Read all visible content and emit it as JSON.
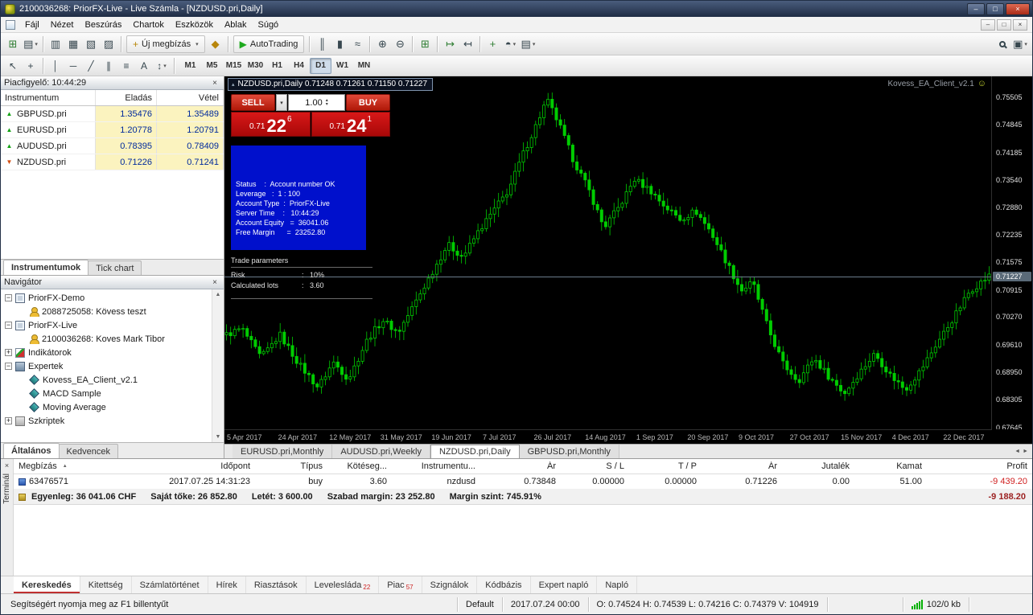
{
  "window": {
    "title": "2100036268: PriorFX-Live - Live Számla - [NZDUSD.pri,Daily]",
    "controls": [
      {
        "name": "minimize-button",
        "glyph": "–"
      },
      {
        "name": "restore-button",
        "glyph": "□"
      },
      {
        "name": "close-button",
        "glyph": "×"
      }
    ]
  },
  "icons": {
    "close": "×",
    "dropdown": "▾",
    "sort_asc": "▲",
    "smiley": "☺",
    "collapse": "▴",
    "tab_left": "◄",
    "tab_right": "►",
    "scroll_up": "▲",
    "scroll_down": "▼",
    "spin_up": "▴",
    "spin_down": "▾"
  },
  "menu": {
    "items": [
      "Fájl",
      "Nézet",
      "Beszúrás",
      "Chartok",
      "Eszközök",
      "Ablak",
      "Súgó"
    ],
    "mdi_controls": [
      {
        "name": "child-minimize-button",
        "glyph": "–"
      },
      {
        "name": "child-restore-button",
        "glyph": "□"
      },
      {
        "name": "child-close-button",
        "glyph": "×"
      }
    ]
  },
  "toolbar": {
    "main_icons": [
      {
        "name": "new-chart-icon",
        "glyph": "⊞",
        "color": "#2e7d32"
      },
      {
        "name": "profiles-icon",
        "glyph": "▤",
        "color": "#37474f",
        "arrow": true
      },
      {
        "sep": true
      },
      {
        "name": "market-watch-icon",
        "glyph": "▥",
        "color": "#37474f"
      },
      {
        "name": "data-window-icon",
        "glyph": "▦",
        "color": "#37474f"
      },
      {
        "name": "navigator-icon",
        "glyph": "▧",
        "color": "#37474f"
      },
      {
        "name": "terminal-icon",
        "glyph": "▨",
        "color": "#37474f"
      },
      {
        "sep": true
      },
      {
        "name": "new-order-button",
        "glyph": "+",
        "color": "#b8860b",
        "label": "Új megbízás",
        "arrow": true
      },
      {
        "name": "metaeditor-icon",
        "glyph": "◆",
        "color": "#b8860b"
      },
      {
        "sep": true
      },
      {
        "name": "autotrading-button",
        "glyph": "▶",
        "color": "#1faa1f",
        "label": "AutoTrading"
      },
      {
        "sep": true
      },
      {
        "name": "bar-chart-icon",
        "glyph": "║",
        "color": "#37474f"
      },
      {
        "name": "candlestick-chart-icon",
        "glyph": "▮",
        "color": "#37474f"
      },
      {
        "name": "line-chart-icon",
        "glyph": "≈",
        "color": "#37474f"
      },
      {
        "sep": true
      },
      {
        "name": "zoom-in-icon",
        "glyph": "⊕",
        "color": "#37474f"
      },
      {
        "name": "zoom-out-icon",
        "glyph": "⊖",
        "color": "#37474f"
      },
      {
        "sep": true
      },
      {
        "name": "tile-windows-icon",
        "glyph": "⊞",
        "color": "#2e7d32"
      },
      {
        "sep": true
      },
      {
        "name": "auto-scroll-icon",
        "glyph": "↦",
        "color": "#2e7d32"
      },
      {
        "name": "chart-shift-icon",
        "glyph": "↤",
        "color": "#37474f"
      },
      {
        "sep": true
      },
      {
        "name": "indicators-icon",
        "glyph": "+",
        "color": "#2e7d32"
      },
      {
        "name": "periods-icon",
        "glyph": "◓",
        "color": "#37474f",
        "arrow": true
      },
      {
        "name": "templates-icon",
        "glyph": "▤",
        "color": "#37474f",
        "arrow": true
      }
    ],
    "right_icons": [
      {
        "name": "search-icon",
        "glyph": "magnifier"
      },
      {
        "name": "window-layout-icon",
        "glyph": "▣",
        "color": "#37474f",
        "arrow": true
      }
    ],
    "draw_icons": [
      {
        "name": "cursor-icon",
        "glyph": "↖"
      },
      {
        "name": "crosshair-icon",
        "glyph": "+"
      },
      {
        "sep": true
      },
      {
        "name": "vertical-line-icon",
        "glyph": "│"
      },
      {
        "name": "horizontal-line-icon",
        "glyph": "─"
      },
      {
        "name": "trendline-icon",
        "glyph": "╱"
      },
      {
        "name": "channel-icon",
        "glyph": "∥"
      },
      {
        "name": "fibonacci-icon",
        "glyph": "≡"
      },
      {
        "name": "text-icon",
        "glyph": "A"
      },
      {
        "name": "arrows-icon",
        "glyph": "↕",
        "arrow": true
      },
      {
        "sep": true
      }
    ],
    "timeframes": [
      "M1",
      "M5",
      "M15",
      "M30",
      "H1",
      "H4",
      "D1",
      "W1",
      "MN"
    ],
    "active_timeframe": "D1"
  },
  "market_watch": {
    "title": "Piacfigyelő: 10:44:29",
    "columns": [
      "Instrumentum",
      "Eladás",
      "Vétel"
    ],
    "rows": [
      {
        "symbol": "GBPUSD.pri",
        "bid": "1.35476",
        "ask": "1.35489",
        "dir": "up"
      },
      {
        "symbol": "EURUSD.pri",
        "bid": "1.20778",
        "ask": "1.20791",
        "dir": "up"
      },
      {
        "symbol": "AUDUSD.pri",
        "bid": "0.78395",
        "ask": "0.78409",
        "dir": "up"
      },
      {
        "symbol": "NZDUSD.pri",
        "bid": "0.71226",
        "ask": "0.71241",
        "dir": "down"
      }
    ],
    "tabs": [
      {
        "label": "Instrumentumok",
        "active": true
      },
      {
        "label": "Tick chart",
        "active": false
      }
    ]
  },
  "navigator": {
    "title": "Navigátor",
    "tree": [
      {
        "label": "PriorFX-Demo",
        "depth": 0,
        "icon": "platform",
        "expand": "open"
      },
      {
        "label": "2088725058: Kövess teszt",
        "depth": 1,
        "icon": "account"
      },
      {
        "label": "PriorFX-Live",
        "depth": 0,
        "icon": "platform",
        "expand": "open"
      },
      {
        "label": "2100036268: Koves Mark Tibor",
        "depth": 1,
        "icon": "account"
      },
      {
        "label": "Indikátorok",
        "depth": 0,
        "icon": "indicators",
        "expand": "closed"
      },
      {
        "label": "Expertek",
        "depth": 0,
        "icon": "experts",
        "expand": "open"
      },
      {
        "label": "Kovess_EA_Client_v2.1",
        "depth": 1,
        "icon": "expert"
      },
      {
        "label": "MACD Sample",
        "depth": 1,
        "icon": "expert"
      },
      {
        "label": "Moving Average",
        "depth": 1,
        "icon": "expert"
      },
      {
        "label": "Szkriptek",
        "depth": 0,
        "icon": "scripts",
        "expand": "closed"
      }
    ],
    "tabs": [
      {
        "label": "Általános",
        "active": true
      },
      {
        "label": "Kedvencek",
        "active": false
      }
    ]
  },
  "chart": {
    "header": "NZDUSD.pri,Daily  0.71248 0.71261 0.71150 0.71227",
    "ea_name": "Kovess_EA_Client_v2.1",
    "one_click": {
      "sell_label": "SELL",
      "buy_label": "BUY",
      "lots": "1.00",
      "sell_small": "0.71",
      "sell_big": "22",
      "sell_sup": "6",
      "buy_small": "0.71",
      "buy_big": "24",
      "buy_sup": "1"
    },
    "info_lines": [
      "Status    :  Account number OK",
      "Leverage   :  1 : 100",
      "Account Type  :  PriorFX-Live",
      "Server Time    :   10:44:29",
      "Account Equity   =  36041.06",
      "Free Margin      =  23252.80"
    ],
    "params_title": "Trade parameters",
    "params": [
      {
        "label": "Risk",
        "value": "10%"
      },
      {
        "label": "Calculated lots",
        "value": "3.60"
      }
    ],
    "price_scale": [
      "0.75505",
      "0.74845",
      "0.74185",
      "0.73540",
      "0.72880",
      "0.72235",
      "0.71575",
      "0.70915",
      "0.70270",
      "0.69610",
      "0.68950",
      "0.68305",
      "0.67645"
    ],
    "current_price": "0.71227",
    "dates": [
      "5 Apr 2017",
      "24 Apr 2017",
      "12 May 2017",
      "31 May 2017",
      "19 Jun 2017",
      "7 Jul 2017",
      "26 Jul 2017",
      "14 Aug 2017",
      "1 Sep 2017",
      "20 Sep 2017",
      "9 Oct 2017",
      "27 Oct 2017",
      "15 Nov 2017",
      "4 Dec 2017",
      "22 Dec 2017"
    ],
    "scale": {
      "min": 0.676,
      "max": 0.76
    },
    "candle_count": 186,
    "anchors": [
      [
        0,
        0.6985
      ],
      [
        0.02,
        0.7
      ],
      [
        0.045,
        0.693
      ],
      [
        0.07,
        0.6985
      ],
      [
        0.095,
        0.6915
      ],
      [
        0.12,
        0.686
      ],
      [
        0.14,
        0.692
      ],
      [
        0.16,
        0.688
      ],
      [
        0.185,
        0.6975
      ],
      [
        0.205,
        0.702
      ],
      [
        0.225,
        0.699
      ],
      [
        0.25,
        0.707
      ],
      [
        0.27,
        0.7135
      ],
      [
        0.29,
        0.72
      ],
      [
        0.31,
        0.717
      ],
      [
        0.33,
        0.723
      ],
      [
        0.35,
        0.728
      ],
      [
        0.37,
        0.733
      ],
      [
        0.39,
        0.742
      ],
      [
        0.405,
        0.748
      ],
      [
        0.42,
        0.7545
      ],
      [
        0.435,
        0.749
      ],
      [
        0.455,
        0.74
      ],
      [
        0.475,
        0.733
      ],
      [
        0.495,
        0.724
      ],
      [
        0.515,
        0.729
      ],
      [
        0.535,
        0.7355
      ],
      [
        0.555,
        0.733
      ],
      [
        0.575,
        0.729
      ],
      [
        0.595,
        0.726
      ],
      [
        0.615,
        0.728
      ],
      [
        0.635,
        0.723
      ],
      [
        0.655,
        0.716
      ],
      [
        0.675,
        0.709
      ],
      [
        0.69,
        0.711
      ],
      [
        0.71,
        0.7
      ],
      [
        0.73,
        0.6915
      ],
      [
        0.75,
        0.6875
      ],
      [
        0.77,
        0.693
      ],
      [
        0.79,
        0.6885
      ],
      [
        0.81,
        0.6845
      ],
      [
        0.83,
        0.6895
      ],
      [
        0.85,
        0.694
      ],
      [
        0.87,
        0.689
      ],
      [
        0.89,
        0.6855
      ],
      [
        0.91,
        0.69
      ],
      [
        0.93,
        0.696
      ],
      [
        0.955,
        0.703
      ],
      [
        0.975,
        0.709
      ],
      [
        1,
        0.7125
      ]
    ]
  },
  "chart_tabs": {
    "items": [
      {
        "label": "EURUSD.pri,Monthly",
        "active": false
      },
      {
        "label": "AUDUSD.pri,Weekly",
        "active": false
      },
      {
        "label": "NZDUSD.pri,Daily",
        "active": true
      },
      {
        "label": "GBPUSD.pri,Monthly",
        "active": false
      }
    ]
  },
  "terminal": {
    "side_label": "Terminál",
    "columns": [
      "Megbízás",
      "Időpont",
      "Típus",
      "Kötéseg...",
      "Instrumentu...",
      "Ár",
      "S / L",
      "T / P",
      "Ár",
      "Jutalék",
      "Kamat",
      "Profit"
    ],
    "order": {
      "id": "63476571",
      "time": "2017.07.25 14:31:23",
      "type": "buy",
      "lots": "3.60",
      "symbol": "nzdusd",
      "open_price": "0.73848",
      "sl": "0.00000",
      "tp": "0.00000",
      "price": "0.71226",
      "commission": "0.00",
      "swap": "51.00",
      "profit": "-9 439.20"
    },
    "balance": {
      "segments": [
        "Egyenleg: 36 041.06 CHF",
        "Saját tőke: 26 852.80",
        "Letét: 3 600.00",
        "Szabad margin: 23 252.80",
        "Margin szint: 745.91%"
      ],
      "profit": "-9 188.20"
    },
    "tabs": [
      {
        "label": "Kereskedés",
        "active": true
      },
      {
        "label": "Kitettség"
      },
      {
        "label": "Számlatörténet"
      },
      {
        "label": "Hírek"
      },
      {
        "label": "Riasztások"
      },
      {
        "label": "Levelesláda",
        "badge": "22"
      },
      {
        "label": "Piac",
        "badge": "57"
      },
      {
        "label": "Szignálok"
      },
      {
        "label": "Kódbázis"
      },
      {
        "label": "Expert napló"
      },
      {
        "label": "Napló"
      }
    ]
  },
  "status": {
    "help": "Segítségért nyomja meg az F1 billentyűt",
    "profile": "Default",
    "bar_time": "2017.07.24 00:00",
    "ohlcv": "O: 0.74524   H: 0.74539   L: 0.74216   C: 0.74379   V: 104919",
    "traffic": "102/0 kb"
  }
}
